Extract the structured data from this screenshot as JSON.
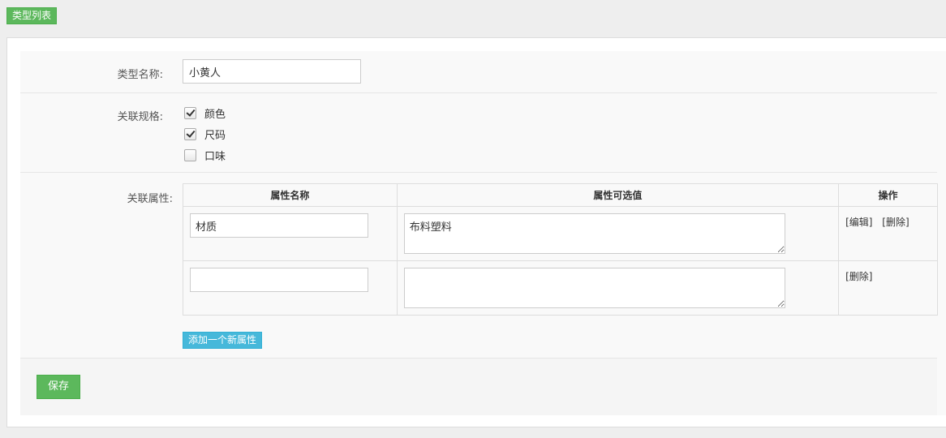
{
  "toolbar": {
    "type_list_label": "类型列表"
  },
  "form": {
    "type_name": {
      "label": "类型名称:",
      "value": "小黄人"
    },
    "specs": {
      "label": "关联规格:",
      "options": [
        {
          "label": "颜色",
          "checked": true
        },
        {
          "label": "尺码",
          "checked": true
        },
        {
          "label": "口味",
          "checked": false
        }
      ]
    },
    "attributes": {
      "label": "关联属性:",
      "headers": [
        "属性名称",
        "属性可选值",
        "操作"
      ],
      "rows": [
        {
          "name": "材质",
          "values": "布料塑料",
          "actions": [
            "[编辑]",
            "[删除]"
          ]
        },
        {
          "name": "",
          "values": "",
          "actions": [
            "[删除]"
          ]
        }
      ],
      "add_label": "添加一个新属性"
    },
    "save_label": "保存"
  },
  "colors": {
    "green": "#5cb85c",
    "blue": "#46b8da"
  }
}
